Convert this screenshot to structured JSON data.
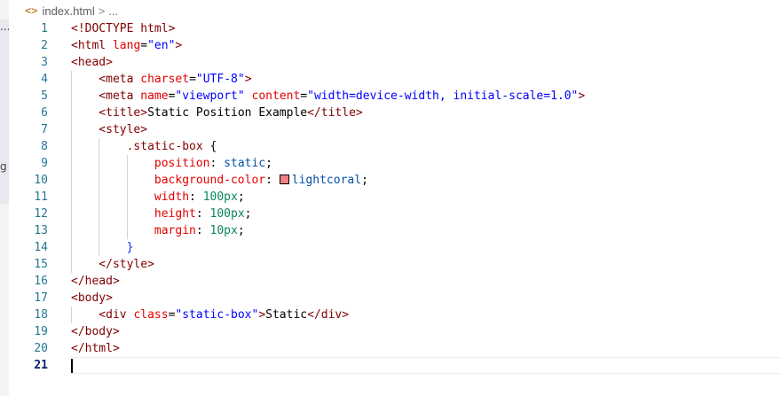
{
  "breadcrumb": {
    "icon": "<>",
    "file": "index.html",
    "separator": ">",
    "ellipsis": "..."
  },
  "sidebar": {
    "fragment_top": "...",
    "fragment_mid": "g"
  },
  "editor": {
    "current_line": 21,
    "colors": {
      "swatch": "#f08080",
      "line_number": "#237893",
      "current_line_number": "#0b216f"
    },
    "lines": [
      {
        "n": "1",
        "guides": 0,
        "tokens": [
          {
            "c": "t-tag",
            "t": "<!DOCTYPE html>"
          }
        ]
      },
      {
        "n": "2",
        "guides": 0,
        "tokens": [
          {
            "c": "t-tag",
            "t": "<html "
          },
          {
            "c": "t-attr",
            "t": "lang"
          },
          {
            "c": "t-punc",
            "t": "="
          },
          {
            "c": "t-str",
            "t": "\"en\""
          },
          {
            "c": "t-tag",
            "t": ">"
          }
        ]
      },
      {
        "n": "3",
        "guides": 0,
        "tokens": [
          {
            "c": "t-tag",
            "t": "<head>"
          }
        ]
      },
      {
        "n": "4",
        "guides": 1,
        "tokens": [
          {
            "c": "t-tag",
            "t": "<meta "
          },
          {
            "c": "t-attr",
            "t": "charset"
          },
          {
            "c": "t-punc",
            "t": "="
          },
          {
            "c": "t-str",
            "t": "\"UTF-8\""
          },
          {
            "c": "t-tag",
            "t": ">"
          }
        ]
      },
      {
        "n": "5",
        "guides": 1,
        "tokens": [
          {
            "c": "t-tag",
            "t": "<meta "
          },
          {
            "c": "t-attr",
            "t": "name"
          },
          {
            "c": "t-punc",
            "t": "="
          },
          {
            "c": "t-str",
            "t": "\"viewport\""
          },
          {
            "c": "t-text",
            "t": " "
          },
          {
            "c": "t-attr",
            "t": "content"
          },
          {
            "c": "t-punc",
            "t": "="
          },
          {
            "c": "t-str",
            "t": "\"width=device-width, initial-scale=1.0\""
          },
          {
            "c": "t-tag",
            "t": ">"
          }
        ]
      },
      {
        "n": "6",
        "guides": 1,
        "tokens": [
          {
            "c": "t-tag",
            "t": "<title>"
          },
          {
            "c": "t-text",
            "t": "Static Position Example"
          },
          {
            "c": "t-tag",
            "t": "</title>"
          }
        ]
      },
      {
        "n": "7",
        "guides": 1,
        "tokens": [
          {
            "c": "t-tag",
            "t": "<style>"
          }
        ]
      },
      {
        "n": "8",
        "guides": 2,
        "tokens": [
          {
            "c": "t-sel",
            "t": ".static-box"
          },
          {
            "c": "t-text",
            "t": " "
          },
          {
            "c": "t-punc",
            "t": "{"
          }
        ]
      },
      {
        "n": "9",
        "guides": 3,
        "tokens": [
          {
            "c": "t-prop",
            "t": "position"
          },
          {
            "c": "t-punc",
            "t": ": "
          },
          {
            "c": "t-val",
            "t": "static"
          },
          {
            "c": "t-punc",
            "t": ";"
          }
        ]
      },
      {
        "n": "10",
        "guides": 3,
        "tokens": [
          {
            "c": "t-prop",
            "t": "background-color"
          },
          {
            "c": "t-punc",
            "t": ": "
          },
          {
            "c": "swatch",
            "t": ""
          },
          {
            "c": "t-val",
            "t": "lightcoral"
          },
          {
            "c": "t-punc",
            "t": ";"
          }
        ]
      },
      {
        "n": "11",
        "guides": 3,
        "tokens": [
          {
            "c": "t-prop",
            "t": "width"
          },
          {
            "c": "t-punc",
            "t": ": "
          },
          {
            "c": "t-num",
            "t": "100px"
          },
          {
            "c": "t-punc",
            "t": ";"
          }
        ]
      },
      {
        "n": "12",
        "guides": 3,
        "tokens": [
          {
            "c": "t-prop",
            "t": "height"
          },
          {
            "c": "t-punc",
            "t": ": "
          },
          {
            "c": "t-num",
            "t": "100px"
          },
          {
            "c": "t-punc",
            "t": ";"
          }
        ]
      },
      {
        "n": "13",
        "guides": 3,
        "tokens": [
          {
            "c": "t-prop",
            "t": "margin"
          },
          {
            "c": "t-punc",
            "t": ": "
          },
          {
            "c": "t-num",
            "t": "10px"
          },
          {
            "c": "t-punc",
            "t": ";"
          }
        ]
      },
      {
        "n": "14",
        "guides": 2,
        "tokens": [
          {
            "c": "t-brace",
            "t": "}"
          }
        ]
      },
      {
        "n": "15",
        "guides": 1,
        "tokens": [
          {
            "c": "t-tag",
            "t": "</style>"
          }
        ]
      },
      {
        "n": "16",
        "guides": 0,
        "tokens": [
          {
            "c": "t-tag",
            "t": "</head>"
          }
        ]
      },
      {
        "n": "17",
        "guides": 0,
        "tokens": [
          {
            "c": "t-tag",
            "t": "<body>"
          }
        ]
      },
      {
        "n": "18",
        "guides": 1,
        "tokens": [
          {
            "c": "t-tag",
            "t": "<div "
          },
          {
            "c": "t-attr",
            "t": "class"
          },
          {
            "c": "t-punc",
            "t": "="
          },
          {
            "c": "t-str",
            "t": "\"static-box\""
          },
          {
            "c": "t-tag",
            "t": ">"
          },
          {
            "c": "t-text",
            "t": "Static"
          },
          {
            "c": "t-tag",
            "t": "</div>"
          }
        ]
      },
      {
        "n": "19",
        "guides": 0,
        "tokens": [
          {
            "c": "t-tag",
            "t": "</body>"
          }
        ]
      },
      {
        "n": "20",
        "guides": 0,
        "tokens": [
          {
            "c": "t-tag",
            "t": "</html>"
          }
        ]
      },
      {
        "n": "21",
        "guides": 0,
        "tokens": []
      }
    ]
  }
}
